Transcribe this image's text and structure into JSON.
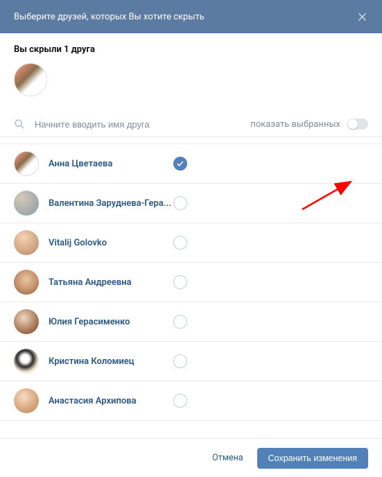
{
  "header": {
    "title": "Выберите друзей, которых Вы хотите скрыть"
  },
  "hidden_section": {
    "label": "Вы скрыли 1 друга"
  },
  "search": {
    "placeholder": "Начните вводить имя друга",
    "show_selected_label": "показать выбранных"
  },
  "friends": [
    {
      "name": "Анна Цветаева",
      "selected": true,
      "avatar_class": "av0"
    },
    {
      "name": "Валентина Заруднева-Гера...",
      "selected": false,
      "avatar_class": "av1"
    },
    {
      "name": "Vitalij Golovko",
      "selected": false,
      "avatar_class": "av2"
    },
    {
      "name": "Татьяна Андреевна",
      "selected": false,
      "avatar_class": "av3"
    },
    {
      "name": "Юлия Герасименко",
      "selected": false,
      "avatar_class": "av4"
    },
    {
      "name": "Кристина Коломиец",
      "selected": false,
      "avatar_class": "av5"
    },
    {
      "name": "Анастасия Архипова",
      "selected": false,
      "avatar_class": "av6"
    }
  ],
  "footer": {
    "cancel_label": "Отмена",
    "save_label": "Сохранить изменения"
  },
  "colors": {
    "header_bg": "#5b7ba3",
    "accent": "#5181b8",
    "link": "#2a5885"
  }
}
